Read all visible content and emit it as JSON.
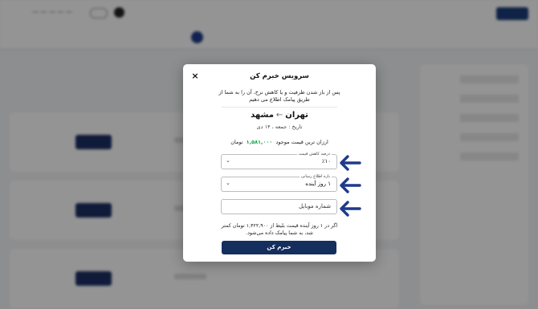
{
  "modal": {
    "title": "سرویس خبرم کن",
    "close_icon": "×",
    "description": "پس از باز شدن ظرفیت و یا کاهش نرخ، آن را به شما از طریق پیامک اطلاع می دهیم",
    "route": {
      "origin": "تهران",
      "arrow": "←",
      "destination": "مشهد"
    },
    "date": "تاریخ : جمعه ، ۱۴ دی",
    "cheapest": {
      "prefix": "ارزان ترین قیمت موجود",
      "amount": "۱,۵۸۱,۰۰۰",
      "unit": "تومان"
    },
    "discount_field": {
      "legend": "درصد کاهش قیمت",
      "value": "٪۱۰",
      "icon": "chevron-down-icon"
    },
    "notify_field": {
      "legend": "بازه اطلاع رسانی",
      "value": "۱ روز آینده",
      "icon": "chevron-down-icon"
    },
    "mobile_field": {
      "placeholder": "شماره موبایل"
    },
    "note": "اگر در ۱ روز آینده قیمت بلیط از ۱,۴۲۲,۹۰۰ تومان کمتر شد، به شما پیامک داده می‌شود.",
    "submit_label": "خبرم کن"
  },
  "annotations": {
    "arrow_color": "#1e3a8a"
  }
}
